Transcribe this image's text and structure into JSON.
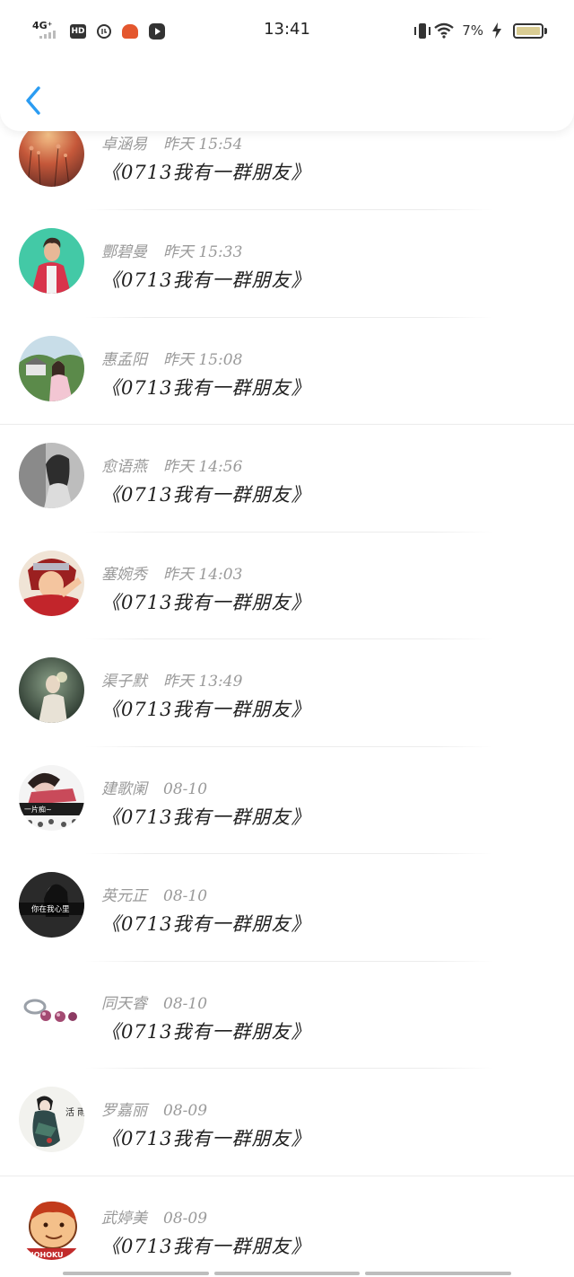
{
  "status_bar": {
    "network": "4G⁺",
    "hd": "HD",
    "circle_icon_text": "?",
    "time": "13:41",
    "battery_percent": "7%",
    "battery_level": 0.07
  },
  "nav": {
    "back_icon": "chevron-left-icon",
    "accent_color": "#2b9cf2"
  },
  "items": [
    {
      "name": "卓涵易",
      "time": "昨天 15:54",
      "title": "《0713我有一群朋友》"
    },
    {
      "name": "酆碧曼",
      "time": "昨天 15:33",
      "title": "《0713我有一群朋友》"
    },
    {
      "name": "惠孟阳",
      "time": "昨天 15:08",
      "title": "《0713我有一群朋友》"
    },
    {
      "name": "愈语燕",
      "time": "昨天 14:56",
      "title": "《0713我有一群朋友》"
    },
    {
      "name": "塞婉秀",
      "time": "昨天 14:03",
      "title": "《0713我有一群朋友》"
    },
    {
      "name": "渠子默",
      "time": "昨天 13:49",
      "title": "《0713我有一群朋友》"
    },
    {
      "name": "建歌阑",
      "time": "08-10",
      "title": "《0713我有一群朋友》",
      "avatar_text": "一片痴~"
    },
    {
      "name": "英元正",
      "time": "08-10",
      "title": "《0713我有一群朋友》",
      "avatar_text": "你在我心里"
    },
    {
      "name": "同天睿",
      "time": "08-10",
      "title": "《0713我有一群朋友》"
    },
    {
      "name": "罗嘉丽",
      "time": "08-09",
      "title": "《0713我有一群朋友》",
      "avatar_text": "活 雨"
    },
    {
      "name": "武婷美",
      "time": "08-09",
      "title": "《0713我有一群朋友》",
      "avatar_text": "NOHOKU"
    }
  ]
}
